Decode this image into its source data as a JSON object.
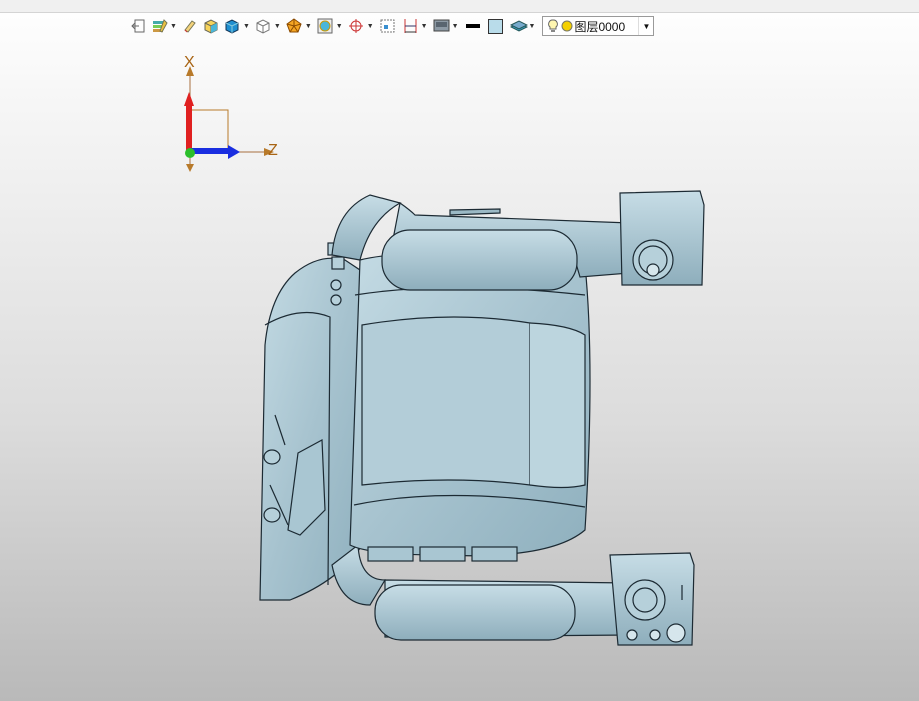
{
  "toolbar": {
    "items": [
      {
        "icon": "exit-icon",
        "has_dropdown": false
      },
      {
        "icon": "palette-icon",
        "has_dropdown": true
      },
      {
        "icon": "eraser-icon",
        "has_dropdown": false
      },
      {
        "icon": "shaded-box-icon",
        "has_dropdown": false
      },
      {
        "icon": "solid-box-icon",
        "has_dropdown": true
      },
      {
        "icon": "wireframe-box-icon",
        "has_dropdown": true
      },
      {
        "icon": "polygon-icon",
        "has_dropdown": true
      },
      {
        "icon": "frame-icon",
        "has_dropdown": true
      },
      {
        "icon": "crosshair-icon",
        "has_dropdown": true
      },
      {
        "icon": "snapshot-icon",
        "has_dropdown": false
      },
      {
        "icon": "dimension-icon",
        "has_dropdown": true
      },
      {
        "icon": "screen-icon",
        "has_dropdown": true
      },
      {
        "icon": "line-weight-icon",
        "has_dropdown": false
      },
      {
        "icon": "fill-color-icon",
        "has_dropdown": false
      },
      {
        "icon": "layers-icon",
        "has_dropdown": true
      }
    ],
    "layer_selector": {
      "value": "图层0000"
    }
  },
  "triad": {
    "x_label": "X",
    "z_label": "Z"
  },
  "colors": {
    "model_fill": "#a9c6d2",
    "model_edge": "#1c2a33",
    "x_axis": "#e02020",
    "z_axis": "#1a2ee0",
    "origin": "#2bbf2b",
    "axis_label": "#a86414"
  }
}
